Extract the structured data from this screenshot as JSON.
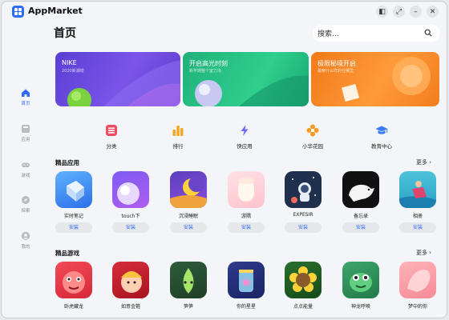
{
  "window": {
    "title": "AppMarket",
    "controls": [
      "split-view-icon",
      "restore-icon",
      "minimize-icon",
      "close-icon"
    ]
  },
  "sidebar": {
    "items": [
      {
        "label": "首页",
        "icon": "home-icon",
        "active": true
      },
      {
        "label": "应用",
        "icon": "apps-icon",
        "active": false
      },
      {
        "label": "游戏",
        "icon": "gamepad-icon",
        "active": false
      },
      {
        "label": "探索",
        "icon": "compass-icon",
        "active": false
      },
      {
        "label": "我的",
        "icon": "profile-icon",
        "active": false
      }
    ]
  },
  "header": {
    "title": "首页",
    "search_placeholder": "搜索..."
  },
  "banners": [
    {
      "title": "NIKE",
      "subtitle": "2020新潮增"
    },
    {
      "title": "开启高光时刻",
      "subtitle": "新学期整个室力冻"
    },
    {
      "title": "极限秘境开启",
      "subtitle": "最精什么样的在哪里"
    }
  ],
  "categories": [
    {
      "label": "分类",
      "icon": "category-icon",
      "color": "#f04b5f"
    },
    {
      "label": "排行",
      "icon": "ranking-icon",
      "color": "#f5a623"
    },
    {
      "label": "快应用",
      "icon": "flash-icon",
      "color": "#6b6bf5"
    },
    {
      "label": "小华花园",
      "icon": "flower-icon",
      "color": "#f59a23"
    },
    {
      "label": "教育中心",
      "icon": "education-icon",
      "color": "#3a7bf5"
    }
  ],
  "featured_apps": {
    "title": "精品应用",
    "more": "更多",
    "items": [
      {
        "name": "实时笔记",
        "action": "安装"
      },
      {
        "name": "touch下",
        "action": "安装"
      },
      {
        "name": "沉浸睡眠",
        "action": "安装"
      },
      {
        "name": "游隅",
        "action": "安装"
      },
      {
        "name": "EXPESIR",
        "action": "安装"
      },
      {
        "name": "备忘录",
        "action": "安装"
      },
      {
        "name": "相册",
        "action": "安装"
      }
    ]
  },
  "featured_games": {
    "title": "精品游戏",
    "more": "更多",
    "items": [
      {
        "name": "卧虎藏龙"
      },
      {
        "name": "如意金箍"
      },
      {
        "name": "笋笋"
      },
      {
        "name": "你的星星"
      },
      {
        "name": "点点能量"
      },
      {
        "name": "神龙呼唤"
      },
      {
        "name": "梦中的你"
      }
    ]
  },
  "colors": {
    "accent": "#2f6bff",
    "background": "#f4f5f8"
  }
}
